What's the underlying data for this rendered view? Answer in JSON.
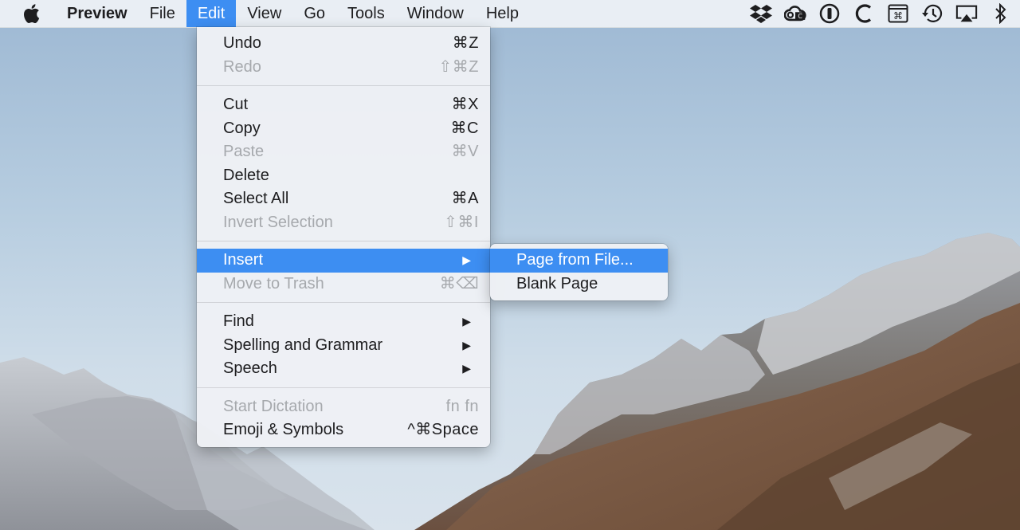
{
  "menubar": {
    "app_name": "Preview",
    "menus": [
      "File",
      "Edit",
      "View",
      "Go",
      "Tools",
      "Window",
      "Help"
    ],
    "active_menu": "Edit",
    "status_icons": [
      "dropbox-icon",
      "creative-cloud-icon",
      "1password-icon",
      "c-app-icon",
      "keyboard-shortcut-icon",
      "time-machine-icon",
      "airplay-icon",
      "bluetooth-icon"
    ]
  },
  "edit_menu": {
    "undo": {
      "label": "Undo",
      "shortcut": "⌘Z"
    },
    "redo": {
      "label": "Redo",
      "shortcut": "⇧⌘Z"
    },
    "cut": {
      "label": "Cut",
      "shortcut": "⌘X"
    },
    "copy": {
      "label": "Copy",
      "shortcut": "⌘C"
    },
    "paste": {
      "label": "Paste",
      "shortcut": "⌘V"
    },
    "delete": {
      "label": "Delete"
    },
    "select_all": {
      "label": "Select All",
      "shortcut": "⌘A"
    },
    "invert_selection": {
      "label": "Invert Selection",
      "shortcut": "⇧⌘I"
    },
    "insert": {
      "label": "Insert"
    },
    "move_to_trash": {
      "label": "Move to Trash",
      "shortcut": "⌘⌫"
    },
    "find": {
      "label": "Find"
    },
    "spelling": {
      "label": "Spelling and Grammar"
    },
    "speech": {
      "label": "Speech"
    },
    "start_dictation": {
      "label": "Start Dictation",
      "shortcut": "fn fn"
    },
    "emoji": {
      "label": "Emoji & Symbols",
      "shortcut": "^⌘Space"
    }
  },
  "insert_submenu": {
    "page_from_file": "Page from File...",
    "blank_page": "Blank Page"
  },
  "colors": {
    "highlight": "#3d8ef2",
    "disabled_text": "#a6a9ad"
  }
}
